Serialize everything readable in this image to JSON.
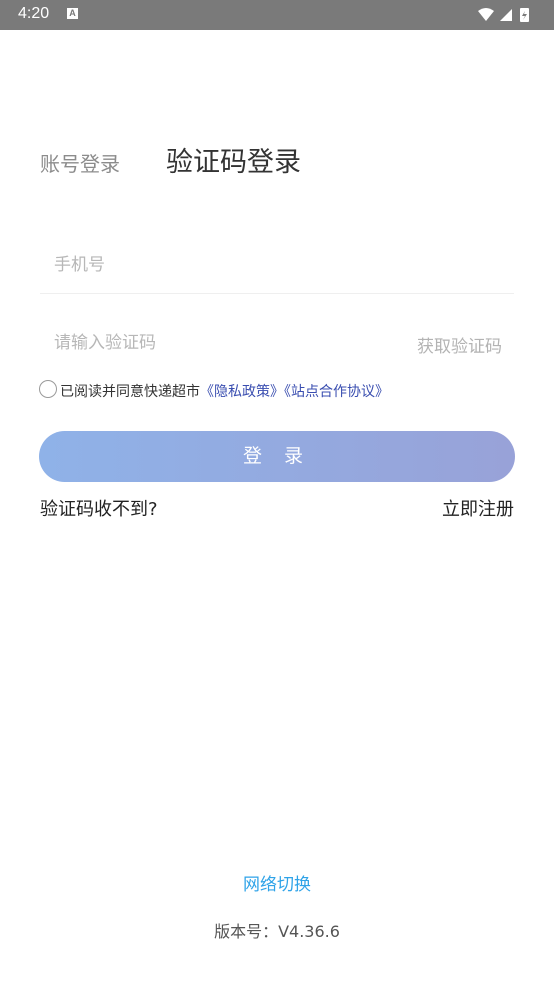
{
  "status_bar": {
    "time": "4:20",
    "notification_icon": "A"
  },
  "tabs": {
    "account_login": "账号登录",
    "code_login": "验证码登录"
  },
  "form": {
    "phone_placeholder": "手机号",
    "code_placeholder": "请输入验证码",
    "get_code": "获取验证码"
  },
  "agreement": {
    "text": "已阅读并同意快递超市",
    "privacy_link": "《隐私政策》",
    "site_link": "《站点合作协议》"
  },
  "login_button": "登 录",
  "no_code": "验证码收不到?",
  "register": "立即注册",
  "network_switch": "网络切换",
  "version": "版本号：V4.36.6"
}
